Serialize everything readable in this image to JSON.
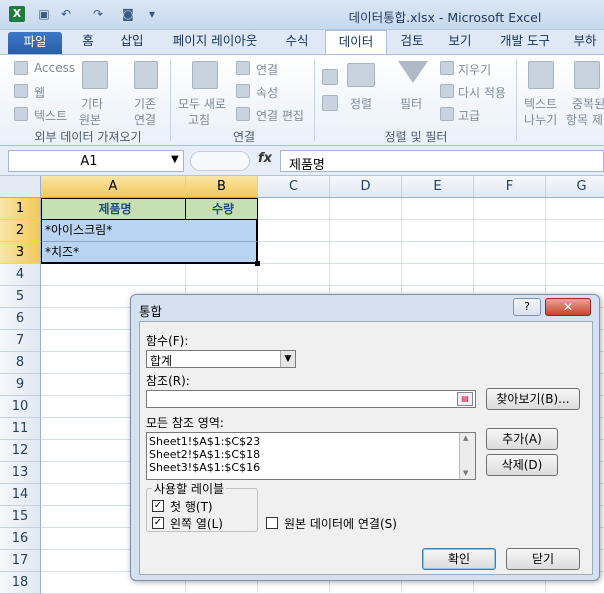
{
  "window": {
    "title": "데이터통합.xlsx  -  Microsoft Excel",
    "app_icon": "X"
  },
  "tabs": [
    {
      "label": "파일"
    },
    {
      "label": "홈"
    },
    {
      "label": "삽입"
    },
    {
      "label": "페이지 레이아웃"
    },
    {
      "label": "수식"
    },
    {
      "label": "데이터"
    },
    {
      "label": "검토"
    },
    {
      "label": "보기"
    },
    {
      "label": "개발 도구"
    },
    {
      "label": "부하"
    }
  ],
  "ribbon": {
    "ext": {
      "access": "Access",
      "web": "웹",
      "text": "텍스트",
      "other": "기타",
      "other2": "원본",
      "existing": "기존",
      "existing2": "연결",
      "group": "외부 데이터 가져오기"
    },
    "conn": {
      "refresh": "모두 새로",
      "refresh2": "고침",
      "connections": "연결",
      "properties": "속성",
      "edit_links": "연결 편집",
      "group": "연결"
    },
    "sort": {
      "sort": "정렬",
      "filter": "필터",
      "clear": "지우기",
      "reapply": "다시 적용",
      "advanced": "고급",
      "group": "정렬 및 필터"
    },
    "tools": {
      "text_to_col": "텍스트",
      "text_to_col2": "나누기",
      "dup": "중복된",
      "dup2": "항목 제"
    }
  },
  "formula_bar": {
    "name_box": "A1",
    "fx": "fx",
    "formula": "제품명"
  },
  "grid": {
    "columns": [
      "A",
      "B",
      "C",
      "D",
      "E",
      "F",
      "G"
    ],
    "rows": [
      "1",
      "2",
      "3",
      "4",
      "5",
      "6",
      "7",
      "8",
      "9",
      "10",
      "11",
      "12",
      "13",
      "14",
      "15",
      "16",
      "17",
      "18"
    ],
    "cells": {
      "A1": "제품명",
      "B1": "수량",
      "A2": "*아이스크림*",
      "A3": "*치즈*"
    },
    "colors": {
      "header_fill": "#c6e0b4",
      "range_fill": "#b8d4f0",
      "selection": "#f2c85b"
    }
  },
  "dialog": {
    "title": "통합",
    "help": "?",
    "close": "✕",
    "function_label": "함수(F):",
    "function_value": "합계",
    "reference_label": "참조(R):",
    "reference_value": "",
    "browse_button": "찾아보기(B)...",
    "all_refs_label": "모든 참조 영역:",
    "refs": [
      "Sheet1!$A$1:$C$23",
      "Sheet2!$A$1:$C$18",
      "Sheet3!$A$1:$C$16"
    ],
    "add_button": "추가(A)",
    "delete_button": "삭제(D)",
    "labels_group": "사용할 레이블",
    "top_row": "첫 행(T)",
    "left_col": "왼쪽 열(L)",
    "link_source": "원본 데이터에 연결(S)",
    "top_row_checked": true,
    "left_col_checked": true,
    "link_source_checked": false,
    "ok_button": "확인",
    "close_button": "닫기"
  }
}
